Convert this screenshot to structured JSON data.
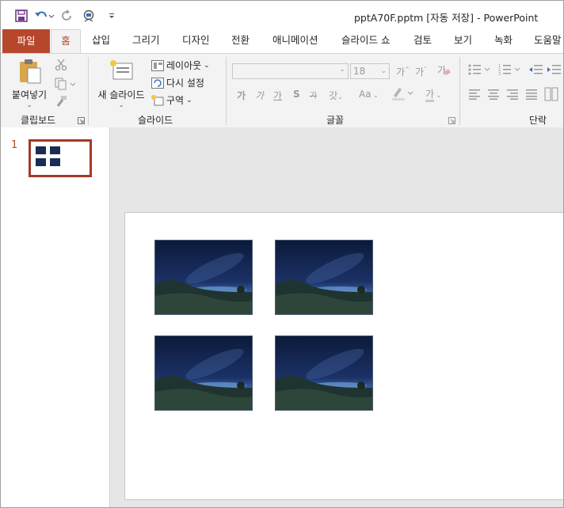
{
  "window": {
    "title": "pptA70F.pptm [자동 저장]  -  PowerPoint"
  },
  "qat": {
    "save_icon": "save-icon",
    "undo_icon": "undo-icon",
    "redo_icon": "redo-icon",
    "present_icon": "present-from-start-icon",
    "customize_icon": "customize-qat-icon"
  },
  "tabs": [
    {
      "label": "파일"
    },
    {
      "label": "홈"
    },
    {
      "label": "삽입"
    },
    {
      "label": "그리기"
    },
    {
      "label": "디자인"
    },
    {
      "label": "전환"
    },
    {
      "label": "애니메이션"
    },
    {
      "label": "슬라이드 쇼"
    },
    {
      "label": "검토"
    },
    {
      "label": "보기"
    },
    {
      "label": "녹화"
    },
    {
      "label": "도움말"
    }
  ],
  "ribbon": {
    "clipboard": {
      "paste_label": "붙여넣기",
      "group_label": "클립보드"
    },
    "slides": {
      "new_slide_label": "새 슬라이드",
      "layout_label": "레이아웃",
      "reset_label": "다시 설정",
      "section_label": "구역",
      "group_label": "슬라이드"
    },
    "font": {
      "font_name_value": "",
      "font_size_value": "18",
      "group_label": "글꼴",
      "bold": "가",
      "italic": "가",
      "underline": "가",
      "shadow": "S",
      "strike": "가",
      "spacing": "갓",
      "case": "Aa",
      "grow": "가",
      "shrink": "가",
      "highlight": "가",
      "color": "가"
    },
    "paragraph": {
      "group_label": "단락"
    }
  },
  "slides_panel": {
    "slide_number": "1"
  },
  "colors": {
    "accent": "#b7472a",
    "ribbon_bg": "#f3f3f3",
    "canvas_bg": "#e6e6e6"
  }
}
